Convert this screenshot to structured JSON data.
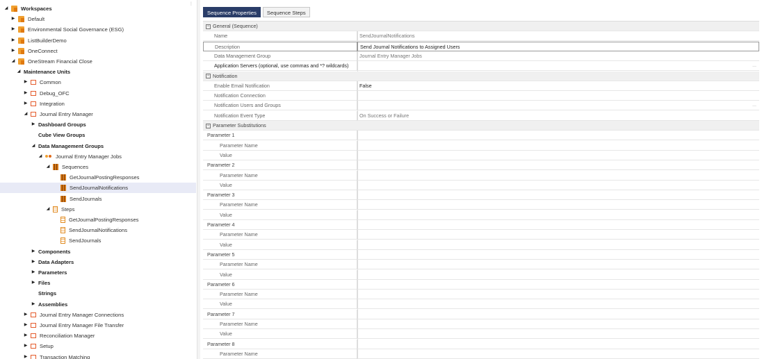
{
  "tree": [
    {
      "label": "Workspaces",
      "depth": 0,
      "tw": "◢",
      "icon": "ws",
      "bold": true
    },
    {
      "label": "Default",
      "depth": 1,
      "tw": "▶",
      "icon": "ws"
    },
    {
      "label": "Environmental Social Governance (ESG)",
      "depth": 1,
      "tw": "▶",
      "icon": "ws"
    },
    {
      "label": "ListBuilderDemo",
      "depth": 1,
      "tw": "▶",
      "icon": "ws"
    },
    {
      "label": "OneConnect",
      "depth": 1,
      "tw": "▶",
      "icon": "ws"
    },
    {
      "label": "OneStream Financial Close",
      "depth": 1,
      "tw": "◢",
      "icon": "ws"
    },
    {
      "label": "Maintenance Units",
      "depth": 2,
      "tw": "◢",
      "icon": "",
      "bold": true
    },
    {
      "label": "Common",
      "depth": 3,
      "tw": "▶",
      "icon": "mu"
    },
    {
      "label": "Debug_OFC",
      "depth": 3,
      "tw": "▶",
      "icon": "mu"
    },
    {
      "label": "Integration",
      "depth": 3,
      "tw": "▶",
      "icon": "mu"
    },
    {
      "label": "Journal Entry Manager",
      "depth": 3,
      "tw": "◢",
      "icon": "mu"
    },
    {
      "label": "Dashboard Groups",
      "depth": 4,
      "tw": "▶",
      "icon": "",
      "bold": true
    },
    {
      "label": "Cube View Groups",
      "depth": 4,
      "tw": "",
      "icon": "",
      "bold": true
    },
    {
      "label": "Data Management Groups",
      "depth": 4,
      "tw": "◢",
      "icon": "",
      "bold": true
    },
    {
      "label": "Journal Entry Manager Jobs",
      "depth": 5,
      "tw": "◢",
      "icon": "dmg"
    },
    {
      "label": "Sequences",
      "depth": 6,
      "tw": "◢",
      "icon": "seq"
    },
    {
      "label": "GetJournalPostingResponses",
      "depth": 7,
      "tw": "",
      "icon": "seq"
    },
    {
      "label": "SendJournalNotifications",
      "depth": 7,
      "tw": "",
      "icon": "seq",
      "selected": true
    },
    {
      "label": "SendJournals",
      "depth": 7,
      "tw": "",
      "icon": "seq"
    },
    {
      "label": "Steps",
      "depth": 6,
      "tw": "◢",
      "icon": "step"
    },
    {
      "label": "GetJournalPostingResponses",
      "depth": 7,
      "tw": "",
      "icon": "step"
    },
    {
      "label": "SendJournalNotifications",
      "depth": 7,
      "tw": "",
      "icon": "step"
    },
    {
      "label": "SendJournals",
      "depth": 7,
      "tw": "",
      "icon": "step"
    },
    {
      "label": "Components",
      "depth": 4,
      "tw": "▶",
      "icon": "",
      "bold": true
    },
    {
      "label": "Data Adapters",
      "depth": 4,
      "tw": "▶",
      "icon": "",
      "bold": true
    },
    {
      "label": "Parameters",
      "depth": 4,
      "tw": "▶",
      "icon": "",
      "bold": true
    },
    {
      "label": "Files",
      "depth": 4,
      "tw": "▶",
      "icon": "",
      "bold": true
    },
    {
      "label": "Strings",
      "depth": 4,
      "tw": "",
      "icon": "",
      "bold": true
    },
    {
      "label": "Assemblies",
      "depth": 4,
      "tw": "▶",
      "icon": "",
      "bold": true
    },
    {
      "label": "Journal Entry Manager Connections",
      "depth": 3,
      "tw": "▶",
      "icon": "mu"
    },
    {
      "label": "Journal Entry Manager File Transfer",
      "depth": 3,
      "tw": "▶",
      "icon": "mu"
    },
    {
      "label": "Reconciliation Manager",
      "depth": 3,
      "tw": "▶",
      "icon": "mu"
    },
    {
      "label": "Setup",
      "depth": 3,
      "tw": "▶",
      "icon": "mu"
    },
    {
      "label": "Transaction Matching",
      "depth": 3,
      "tw": "▶",
      "icon": "mu"
    }
  ],
  "tabs": [
    {
      "label": "Sequence Properties",
      "active": true
    },
    {
      "label": "Sequence Steps",
      "active": false
    }
  ],
  "grid": [
    {
      "kind": "cat",
      "name": "General (Sequence)"
    },
    {
      "kind": "prop",
      "name": "Name",
      "value": "SendJournalNotifications"
    },
    {
      "kind": "prop",
      "name": "Description",
      "value": "Send Journal Notifications to Assigned Users",
      "boxed": true
    },
    {
      "kind": "prop",
      "name": "Data Management Group",
      "value": "Journal Entry Manager Jobs"
    },
    {
      "kind": "prop",
      "name": "Application Servers (optional, use commas and *? wildcards)",
      "value": "",
      "dark": true,
      "ellipsis": "..."
    },
    {
      "kind": "cat",
      "name": "Notification"
    },
    {
      "kind": "prop",
      "name": "Enable Email Notification",
      "value": "False",
      "darkval": true
    },
    {
      "kind": "prop",
      "name": "Notification Connection",
      "value": ""
    },
    {
      "kind": "prop",
      "name": "Notification Users and Groups",
      "value": "",
      "ellipsis": "..."
    },
    {
      "kind": "prop",
      "name": "Notification Event Type",
      "value": "On Success or Failure"
    },
    {
      "kind": "cat",
      "name": "Parameter Substitutions"
    },
    {
      "kind": "grp",
      "name": "Parameter 1"
    },
    {
      "kind": "sub",
      "name": "Parameter Name",
      "value": ""
    },
    {
      "kind": "sub",
      "name": "Value",
      "value": ""
    },
    {
      "kind": "grp",
      "name": "Parameter 2"
    },
    {
      "kind": "sub",
      "name": "Parameter Name",
      "value": ""
    },
    {
      "kind": "sub",
      "name": "Value",
      "value": ""
    },
    {
      "kind": "grp",
      "name": "Parameter 3"
    },
    {
      "kind": "sub",
      "name": "Parameter Name",
      "value": ""
    },
    {
      "kind": "sub",
      "name": "Value",
      "value": ""
    },
    {
      "kind": "grp",
      "name": "Parameter 4"
    },
    {
      "kind": "sub",
      "name": "Parameter Name",
      "value": ""
    },
    {
      "kind": "sub",
      "name": "Value",
      "value": ""
    },
    {
      "kind": "grp",
      "name": "Parameter 5"
    },
    {
      "kind": "sub",
      "name": "Parameter Name",
      "value": ""
    },
    {
      "kind": "sub",
      "name": "Value",
      "value": ""
    },
    {
      "kind": "grp",
      "name": "Parameter 6"
    },
    {
      "kind": "sub",
      "name": "Parameter Name",
      "value": ""
    },
    {
      "kind": "sub",
      "name": "Value",
      "value": ""
    },
    {
      "kind": "grp",
      "name": "Parameter 7"
    },
    {
      "kind": "sub",
      "name": "Parameter Name",
      "value": ""
    },
    {
      "kind": "sub",
      "name": "Value",
      "value": ""
    },
    {
      "kind": "grp",
      "name": "Parameter 8"
    },
    {
      "kind": "sub",
      "name": "Parameter Name",
      "value": ""
    }
  ],
  "tree_menu_glyph": "⋮"
}
